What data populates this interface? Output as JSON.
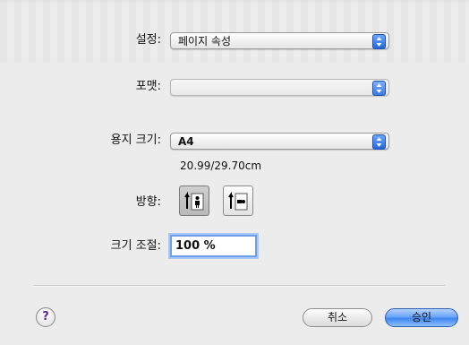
{
  "settings": {
    "label": "설정:",
    "value": "페이지 속성"
  },
  "format": {
    "label": "포맷:",
    "value": ""
  },
  "paper": {
    "label": "용지 크기:",
    "value": "A4",
    "dimensions": "20.99/29.70cm"
  },
  "orientation": {
    "label": "방향:",
    "options": [
      "portrait",
      "landscape"
    ],
    "selected": "portrait"
  },
  "scale": {
    "label": "크기 조절:",
    "value": "100 %"
  },
  "buttons": {
    "help": "?",
    "cancel": "취소",
    "ok": "승인"
  },
  "colors": {
    "accent": "#3f86ee",
    "background": "#ececec"
  }
}
